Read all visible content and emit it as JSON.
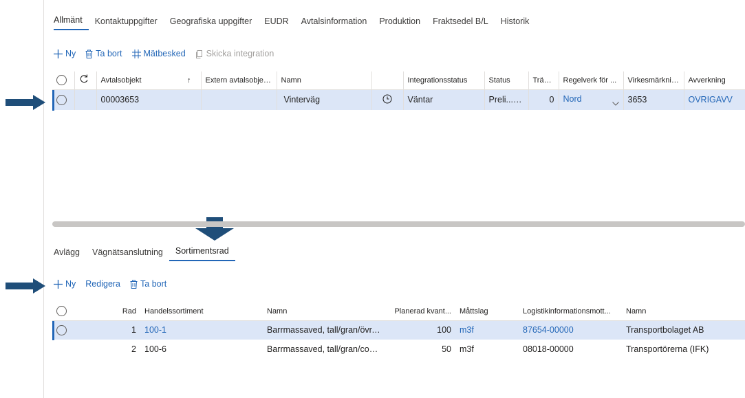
{
  "top_tabs": [
    {
      "label": "Allmänt",
      "active": true
    },
    {
      "label": "Kontaktuppgifter",
      "active": false
    },
    {
      "label": "Geografiska uppgifter",
      "active": false
    },
    {
      "label": "EUDR",
      "active": false
    },
    {
      "label": "Avtalsinformation",
      "active": false
    },
    {
      "label": "Produktion",
      "active": false
    },
    {
      "label": "Fraktsedel B/L",
      "active": false
    },
    {
      "label": "Historik",
      "active": false
    }
  ],
  "top_toolbar": {
    "new_label": "Ny",
    "delete_label": "Ta bort",
    "measure_label": "Mätbesked",
    "integration_label": "Skicka integration"
  },
  "top_grid": {
    "columns": {
      "object": "Avtalsobjekt",
      "external": "Extern avtalsobjek...",
      "name": "Namn",
      "integration": "Integrationsstatus",
      "status": "Status",
      "trees": "Trädå...",
      "rules": "Regelverk för ...",
      "marking": "Virkesmärkning",
      "harvest": "Avverkning"
    },
    "rows": [
      {
        "object": "00003653",
        "external": "",
        "name": "Vinterväg",
        "integration": "Väntar",
        "status": "Preli...",
        "trees": "0",
        "rules": "Nord",
        "marking": "3653",
        "harvest": "OVRIGAVV"
      }
    ]
  },
  "bottom_tabs": [
    {
      "label": "Avlägg",
      "active": false
    },
    {
      "label": "Vägnätsanslutning",
      "active": false
    },
    {
      "label": "Sortimentsrad",
      "active": true
    }
  ],
  "bottom_toolbar": {
    "new_label": "Ny",
    "edit_label": "Redigera",
    "delete_label": "Ta bort"
  },
  "bottom_grid": {
    "columns": {
      "row": "Rad",
      "sortiment": "Handelssortiment",
      "name": "Namn",
      "planned": "Planerad kvant...",
      "unit": "Måttslag",
      "logistics": "Logistikinformationsmott...",
      "name2": "Namn"
    },
    "rows": [
      {
        "row": "1",
        "sortiment": "100-1",
        "name": "Barrmassaved, tall/gran/övr, fall...",
        "planned": "100",
        "unit": "m3f",
        "logistics": "87654-00000",
        "name2": "Transportbolaget AB"
      },
      {
        "row": "2",
        "sortiment": "100-6",
        "name": "Barrmassaved, tall/gran/contort...",
        "planned": "50",
        "unit": "m3f",
        "logistics": "08018-00000",
        "name2": "Transportörerna (IFK)"
      }
    ]
  },
  "colors": {
    "accent": "#2266b7",
    "selected_row": "#dce6f7",
    "arrow": "#1f4e79"
  }
}
